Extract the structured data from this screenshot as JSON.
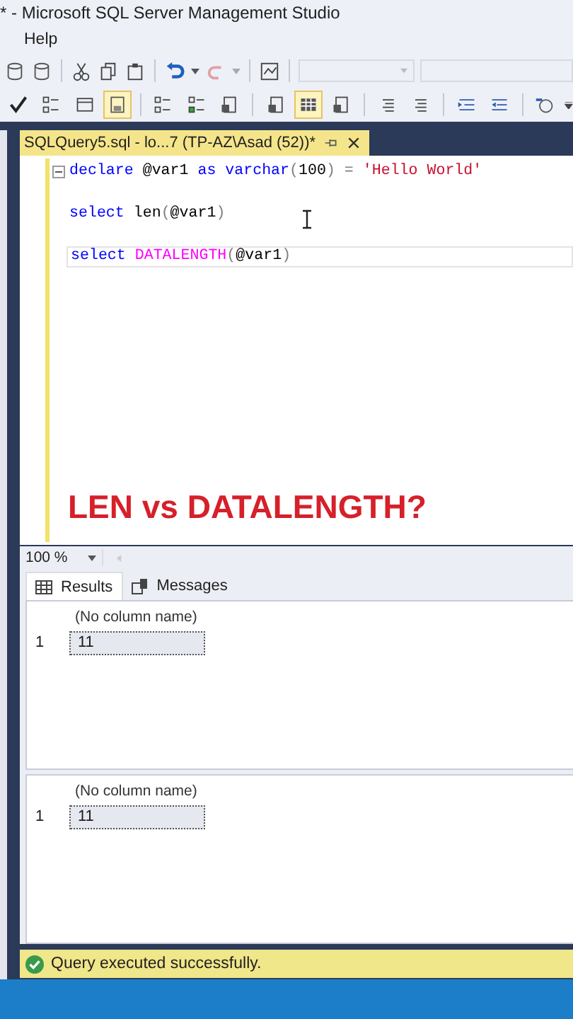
{
  "window": {
    "title": "* - Microsoft SQL Server Management Studio"
  },
  "menu": [
    "Help"
  ],
  "toolbar_2": [
    {
      "on": false
    },
    {
      "on": false
    },
    {
      "on": false
    },
    {
      "on": true
    },
    {
      "on": false
    },
    {
      "on": false
    },
    {
      "on": false
    },
    {
      "on": false
    },
    {
      "on": true
    },
    {
      "on": false
    },
    {
      "on": false
    },
    {
      "on": false
    },
    {
      "on": false
    },
    {
      "on": false
    },
    {
      "on": false
    }
  ],
  "editor_tab": {
    "title": "SQLQuery5.sql - lo...7 (TP-AZ\\Asad (52))*",
    "selected": true
  },
  "code": [
    {
      "current": false,
      "tokens": [
        {
          "kind": "keyword",
          "text": "declare"
        },
        {
          "kind": "plain",
          "text": " @var1 "
        },
        {
          "kind": "keyword",
          "text": "as varchar"
        },
        {
          "kind": "op",
          "text": "("
        },
        {
          "kind": "plain",
          "text": "100"
        },
        {
          "kind": "op",
          "text": ") = "
        },
        {
          "kind": "string",
          "text": "'Hello World'"
        }
      ]
    },
    {
      "current": false
    },
    {
      "current": false,
      "tokens": [
        {
          "kind": "keyword",
          "text": "select"
        },
        {
          "kind": "plain",
          "text": " len"
        },
        {
          "kind": "op",
          "text": "("
        },
        {
          "kind": "plain",
          "text": "@var1"
        },
        {
          "kind": "op",
          "text": ")"
        }
      ]
    },
    {
      "current": false
    },
    {
      "current": true,
      "tokens": [
        {
          "kind": "keyword",
          "text": "select"
        },
        {
          "kind": "function",
          "text": " DATALENGTH"
        },
        {
          "kind": "op",
          "text": "("
        },
        {
          "kind": "plain",
          "text": "@var1"
        },
        {
          "kind": "op",
          "text": ")"
        }
      ]
    }
  ],
  "caption": "LEN vs DATALENGTH?",
  "zoom": "100 %",
  "result_tabs": [
    {
      "label": "Results",
      "selected": true
    },
    {
      "label": "Messages",
      "selected": false
    }
  ],
  "grids": [
    {
      "columns": [
        "(No column name)"
      ],
      "rows": [
        {
          "number": "1",
          "cells": [
            {
              "text": "11",
              "selected": true
            }
          ]
        }
      ]
    },
    {
      "columns": [
        "(No column name)"
      ],
      "rows": [
        {
          "number": "1",
          "cells": [
            {
              "text": "11",
              "selected": true
            }
          ]
        }
      ]
    }
  ],
  "status_bar": {
    "text": "Query executed successfully.",
    "kind": "success"
  }
}
